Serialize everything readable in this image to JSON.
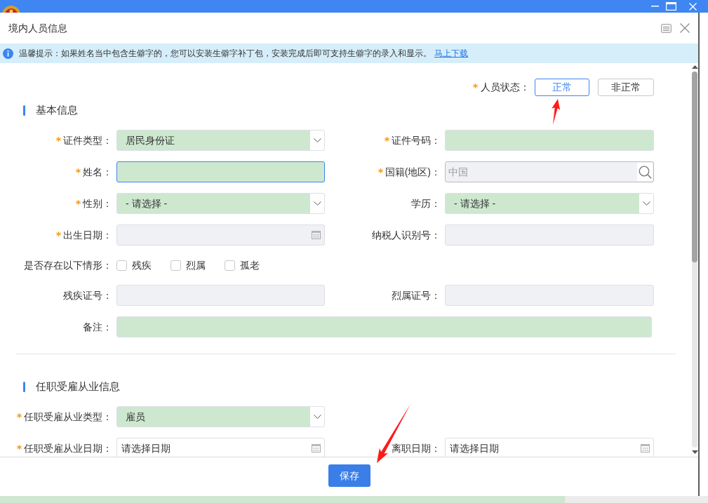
{
  "dialog": {
    "title": "境内人员信息"
  },
  "notice": {
    "text": "温馨提示：如果姓名当中包含生僻字的，您可以安装生僻字补丁包，安装完成后即可支持生僻字的录入和显示。",
    "link": "马上下载"
  },
  "status": {
    "label": "人员状态：",
    "required": true,
    "options": [
      {
        "label": "正常",
        "selected": true
      },
      {
        "label": "非正常",
        "selected": false
      }
    ]
  },
  "sections": [
    {
      "title": "基本信息",
      "rows": [
        {
          "fields": [
            {
              "kind": "select",
              "label": "证件类型：",
              "required": true,
              "value": "居民身份证",
              "disabled": false,
              "focused": false
            },
            {
              "kind": "text",
              "label": "证件号码：",
              "required": true,
              "disabled": false,
              "focused": false
            }
          ]
        },
        {
          "fields": [
            {
              "kind": "text",
              "label": "姓名：",
              "required": true,
              "disabled": false,
              "focused": true
            },
            {
              "kind": "lookup",
              "label": "国籍(地区)：",
              "required": true,
              "value": "中国",
              "disabled": true,
              "focused": false
            }
          ]
        },
        {
          "fields": [
            {
              "kind": "select",
              "label": "性别：",
              "required": true,
              "value": "- 请选择 -",
              "disabled": false,
              "focused": false
            },
            {
              "kind": "select",
              "label": "学历：",
              "required": false,
              "value": "- 请选择 -",
              "disabled": false,
              "focused": false
            }
          ]
        },
        {
          "fields": [
            {
              "kind": "date",
              "label": "出生日期：",
              "required": true,
              "disabled": true,
              "focused": false
            },
            {
              "kind": "text",
              "label": "纳税人识别号：",
              "required": false,
              "disabled": true,
              "focused": false
            }
          ]
        },
        {
          "fields": [
            {
              "kind": "checks",
              "label": "是否存在以下情形：",
              "options": [
                {
                  "label": "残疾",
                  "checked": false
                },
                {
                  "label": "烈属",
                  "checked": false
                },
                {
                  "label": "孤老",
                  "checked": false
                }
              ]
            }
          ]
        },
        {
          "fields": [
            {
              "kind": "text",
              "label": "残疾证号：",
              "required": false,
              "disabled": true,
              "focused": false
            },
            {
              "kind": "text",
              "label": "烈属证号：",
              "required": false,
              "disabled": true,
              "focused": false
            }
          ]
        },
        {
          "fields": [
            {
              "kind": "remark",
              "label": "备注：",
              "required": false,
              "disabled": false,
              "focused": false
            }
          ]
        }
      ]
    },
    {
      "title": "任职受雇从业信息",
      "rows": [
        {
          "fields": [
            {
              "kind": "select",
              "label": "任职受雇从业类型：",
              "required": true,
              "value": "雇员",
              "disabled": false,
              "focused": false
            }
          ]
        },
        {
          "fields": [
            {
              "kind": "date",
              "label": "任职受雇从业日期：",
              "required": true,
              "placeholder": "请选择日期",
              "disabled": false,
              "focused": false
            },
            {
              "kind": "date",
              "label": "离职日期：",
              "required": false,
              "placeholder": "请选择日期",
              "disabled": false,
              "focused": false
            }
          ]
        }
      ]
    }
  ],
  "footer": {
    "buttons": [
      "保存"
    ]
  }
}
